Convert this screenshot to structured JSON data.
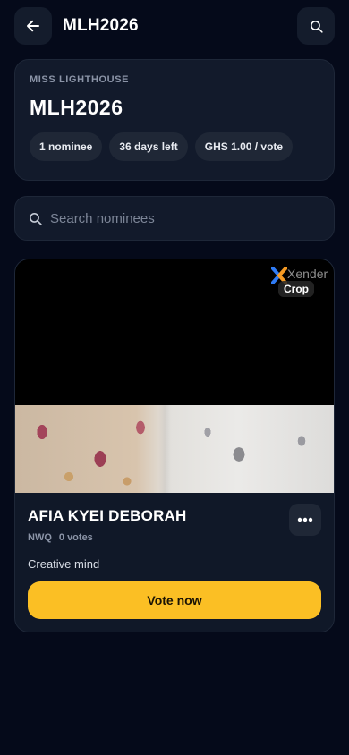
{
  "header": {
    "title": "MLH2026",
    "back_icon": "arrow-left-icon",
    "search_icon": "search-icon"
  },
  "event": {
    "eyebrow": "MISS LIGHTHOUSE",
    "title": "MLH2026",
    "chips": [
      "1 nominee",
      "36 days left",
      "GHS 1.00 / vote"
    ]
  },
  "search": {
    "placeholder": "Search nominees",
    "value": ""
  },
  "nominee": {
    "watermark_brand": "Xender",
    "watermark_tag": "Crop",
    "name": "AFIA KYEI DEBORAH",
    "code": "NWQ",
    "votes": "0 votes",
    "bio": "Creative mind",
    "vote_label": "Vote now",
    "more_icon": "more-horizontal-icon"
  },
  "colors": {
    "background": "#050a1a",
    "card": "#121a2b",
    "chip": "#1f2736",
    "accent": "#fbbf24"
  }
}
